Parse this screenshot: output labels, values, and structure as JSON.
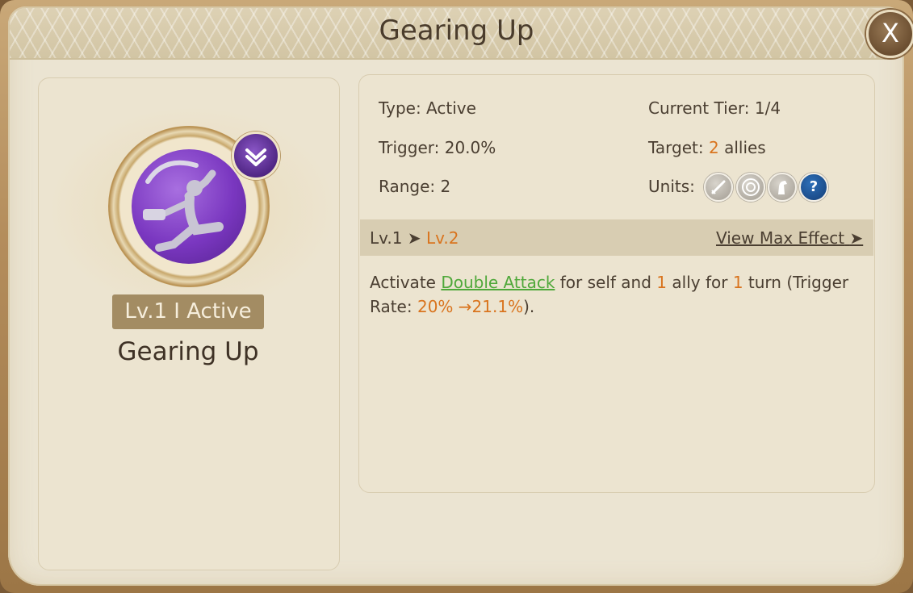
{
  "dialog": {
    "title": "Gearing Up",
    "close_label": "X"
  },
  "skill": {
    "level_status": "Lv.1 I Active",
    "name": "Gearing Up",
    "icon": "skill-martial-artist-icon",
    "upgrade_icon": "chevron-down-icon"
  },
  "info": {
    "type_label": "Type:",
    "type_value": "Active",
    "trigger_label": "Trigger:",
    "trigger_value": "20.0%",
    "range_label": "Range:",
    "range_value": "2",
    "tier_label": "Current Tier:",
    "tier_value": "1/4",
    "target_label": "Target:",
    "target_count": "2",
    "target_unit": "allies",
    "units_label": "Units:",
    "units": [
      "sword-icon",
      "target-icon",
      "horse-icon",
      "question-icon"
    ],
    "question_text": "?"
  },
  "level_bar": {
    "current": "Lv.1",
    "next": "Lv.2",
    "arrow": "➤",
    "max_effect_label": "View Max Effect",
    "max_effect_arrow": "➤"
  },
  "description": {
    "part1": "Activate ",
    "skill_link": "Double Attack",
    "part2": " for self and ",
    "ally_count": "1",
    "part3": " ally for ",
    "turn_count": "1",
    "part4": " turn (Trigger Rate: ",
    "rate_change": "20% →21.1%",
    "part5": ")."
  },
  "colors": {
    "accent_orange": "#d9741e",
    "link_green": "#4fa83a",
    "orb_purple": "#7a37c0"
  }
}
